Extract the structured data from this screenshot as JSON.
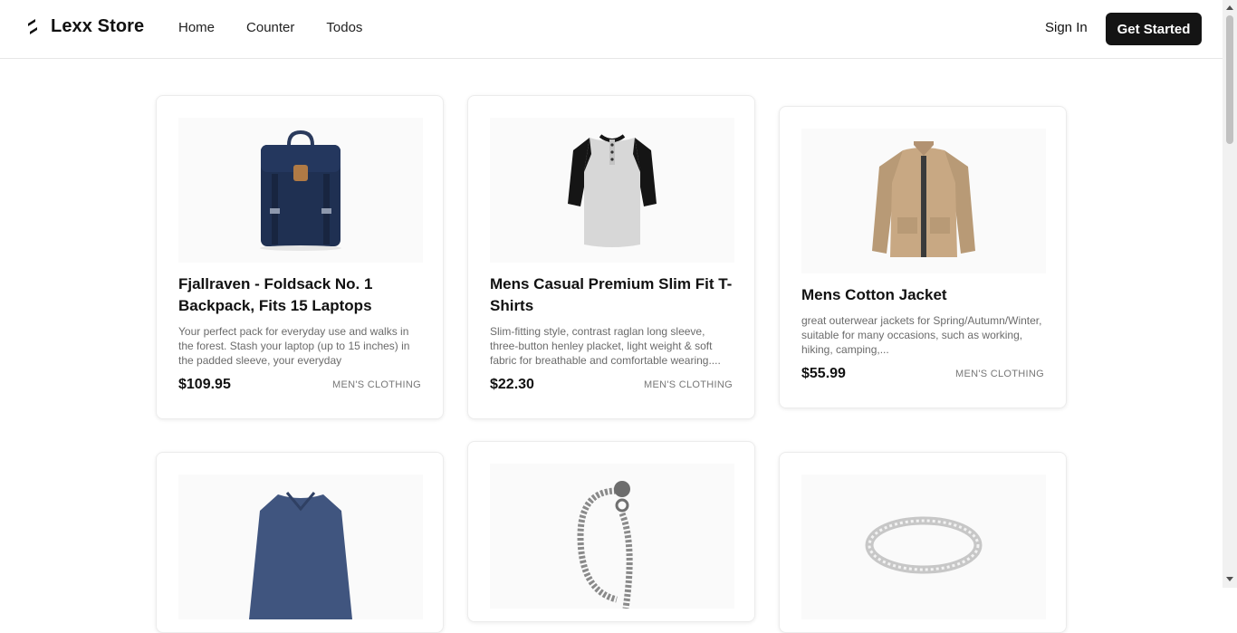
{
  "header": {
    "brand": "Lexx Store",
    "brand_icon": "bolt-logo-icon",
    "nav": [
      "Home",
      "Counter",
      "Todos"
    ],
    "sign_in": "Sign In",
    "cta": "Get Started"
  },
  "products": [
    {
      "title": "Fjallraven - Foldsack No. 1 Backpack, Fits 15 Laptops",
      "description": "Your perfect pack for everyday use and walks in the forest. Stash your laptop (up to 15 inches) in the padded sleeve, your everyday",
      "price": "$109.95",
      "category": "MEN'S CLOTHING",
      "image_icon": "backpack-image"
    },
    {
      "title": "Mens Casual Premium Slim Fit T-Shirts",
      "description": "Slim-fitting style, contrast raglan long sleeve, three-button henley placket, light weight & soft fabric for breathable and comfortable wearing....",
      "price": "$22.30",
      "category": "MEN'S CLOTHING",
      "image_icon": "raglan-tshirt-image"
    },
    {
      "title": "Mens Cotton Jacket",
      "description": "great outerwear jackets for Spring/Autumn/Winter, suitable for many occasions, such as working, hiking, camping,...",
      "price": "$55.99",
      "category": "MEN'S CLOTHING",
      "image_icon": "cotton-jacket-image"
    },
    {
      "image_icon": "longsleeve-shirt-image"
    },
    {
      "image_icon": "dragon-bracelet-image"
    },
    {
      "image_icon": "silver-ring-image"
    }
  ]
}
